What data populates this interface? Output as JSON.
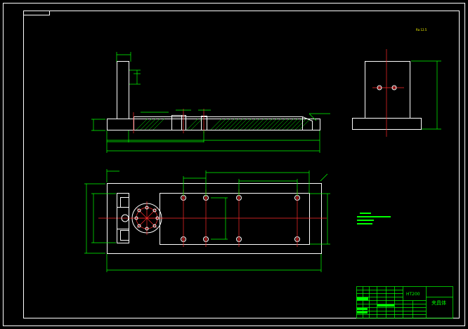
{
  "title_block": {
    "drawing_number": "HT200",
    "part_name": "夹具体"
  },
  "roughness_note": "Ra 12.5",
  "colors": {
    "background": "#000000",
    "outline": "#ffffff",
    "dimension": "#00ff00",
    "centerline": "#ff2a2a",
    "note": "#ffff00"
  }
}
